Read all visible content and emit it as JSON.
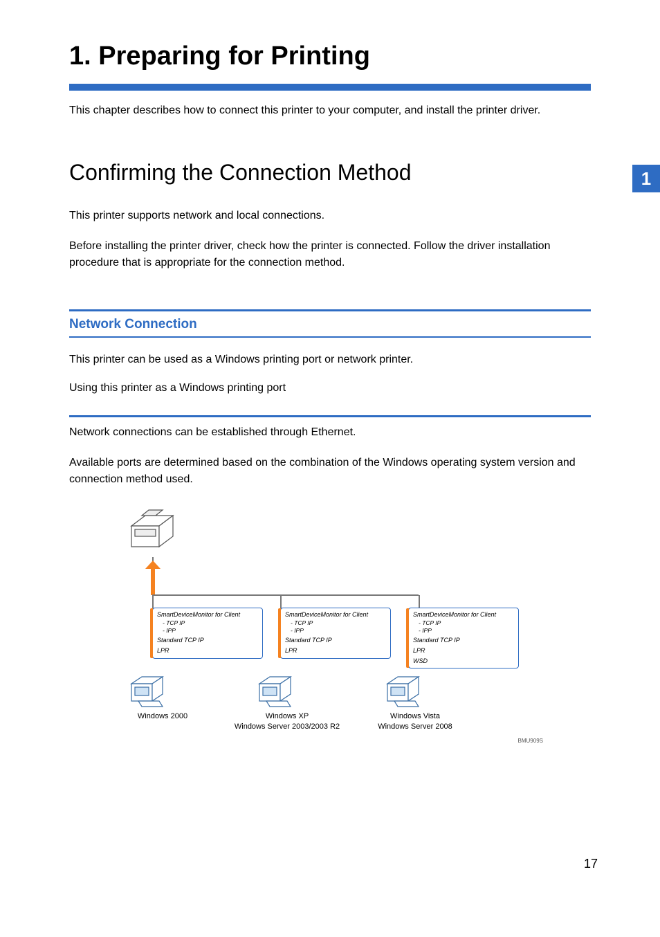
{
  "sideTab": "1",
  "pageNumber": "17",
  "chapter": {
    "title": "1. Preparing for Printing",
    "intro": "This chapter describes how to connect this printer to your computer, and install the printer driver."
  },
  "section": {
    "title": "Confirming the Connection Method",
    "p1": "This printer supports network and local connections.",
    "p2": "Before installing the printer driver, check how the printer is connected. Follow the driver installation procedure that is appropriate for the connection method."
  },
  "subsection": {
    "title": "Network Connection",
    "p1": "This printer can be used as a Windows printing port or network printer.",
    "subsub_title": "Using this printer as a Windows printing port",
    "p2": "Network connections can be established through Ethernet.",
    "p3": "Available ports are determined based on the combination of the Windows operating system version and connection method used."
  },
  "diagram": {
    "code": "BMU909S",
    "columns": [
      {
        "smartdevice": "SmartDeviceMonitor for Client",
        "sub1": "- TCP IP",
        "sub2": "- IPP",
        "standard": "Standard TCP IP",
        "lpr": "LPR",
        "wsd": "",
        "label_line1": "Windows 2000",
        "label_line2": ""
      },
      {
        "smartdevice": "SmartDeviceMonitor for Client",
        "sub1": "- TCP IP",
        "sub2": "- IPP",
        "standard": "Standard TCP IP",
        "lpr": "LPR",
        "wsd": "",
        "label_line1": "Windows XP",
        "label_line2": "Windows Server 2003/2003 R2"
      },
      {
        "smartdevice": "SmartDeviceMonitor for Client",
        "sub1": "- TCP IP",
        "sub2": "- IPP",
        "standard": "Standard TCP IP",
        "lpr": "LPR",
        "wsd": "WSD",
        "label_line1": "Windows Vista",
        "label_line2": "Windows Server 2008"
      }
    ]
  }
}
